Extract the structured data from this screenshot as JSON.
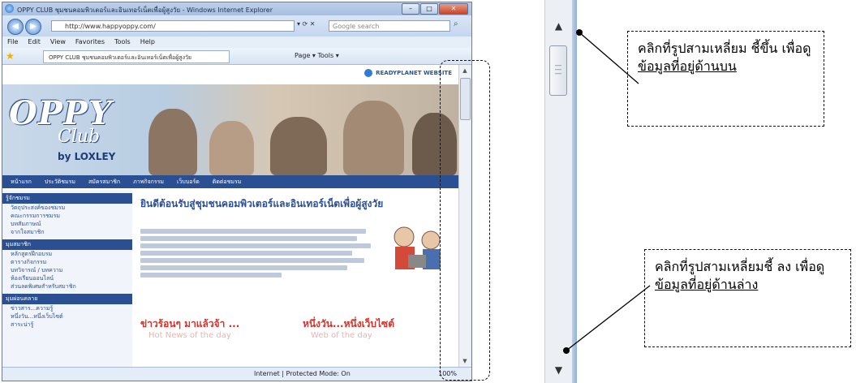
{
  "browser": {
    "title": "OPPY CLUB ชุมชนคอมพิวเตอร์และอินเทอร์เน็ตเพื่อผู้สูงวัย - Windows Internet Explorer",
    "url": "http://www.happyoppy.com/",
    "search_placeholder": "Google search",
    "menu": [
      "File",
      "Edit",
      "View",
      "Favorites",
      "Tools",
      "Help"
    ],
    "tab_title": "OPPY CLUB ชุมชนคอมพิวเตอร์และอินเทอร์เน็ตเพื่อผู้สูงวัย",
    "command_bar": "Page ▾  Tools ▾",
    "status_zone": "Internet | Protected Mode: On",
    "status_zoom": "100%"
  },
  "site": {
    "partner": "READYPLANET WEBSITE",
    "logo_main": "OPPY",
    "logo_club": "Club",
    "logo_by": "by LOXLEY",
    "nav": [
      "หน้าแรก",
      "ประวัติชมรม",
      "สมัครสมาชิก",
      "ภาพกิจกรรม",
      "เว็บบอร์ด",
      "ติดต่อชมรม"
    ],
    "left_sections": [
      {
        "title": "รู้จักชมรม",
        "items": [
          "วัตถุประสงค์ของชมรม",
          "คณะกรรมการชมรม",
          "บทสัมภาษณ์",
          "จากใจสมาชิก"
        ]
      },
      {
        "title": "มุมสมาชิก",
        "items": [
          "หลักสูตรฝึกอบรม",
          "ตารางกิจกรรม",
          "บทวิจารณ์ / บทความ",
          "ห้องเรียนออนไลน์",
          "ส่วนลดพิเศษสำหรับสมาชิก"
        ]
      },
      {
        "title": "มุมผ่อนคลาย",
        "items": [
          "ข่าวสาร...ความรู้",
          "หนึ่งวัน...หนึ่งเว็บไซต์",
          "สาระน่ารู้"
        ]
      }
    ],
    "welcome": "ยินดีต้อนรับสู่ชุมชนคอมพิวเตอร์และอินเทอร์เน็ตเพื่อผู้สูงวัย",
    "news_left_title": "ข่าวร้อนๆ มาแล้วจ้า ...",
    "news_left_sub": "Hot News of the day",
    "news_right_title": "หนึ่งวัน...หนึ่งเว็บไซต์",
    "news_right_sub": "Web of the day"
  },
  "callouts": {
    "top": {
      "prefix": "คลิกที่รูปสามเหลี่ยม ชี้ขึ้น เพื่อดู",
      "underlined": "ข้อมูลที่อยู่ด้านบน"
    },
    "bottom": {
      "prefix": "คลิกที่รูปสามเหลี่ยมชี้ ลง เพื่อดู",
      "underlined": "ข้อมูลที่อยู่ด้านล่าง"
    }
  },
  "icons": {
    "scroll_up": "triangle-up-icon",
    "scroll_down": "triangle-down-icon",
    "grip": "grip-lines-icon"
  }
}
